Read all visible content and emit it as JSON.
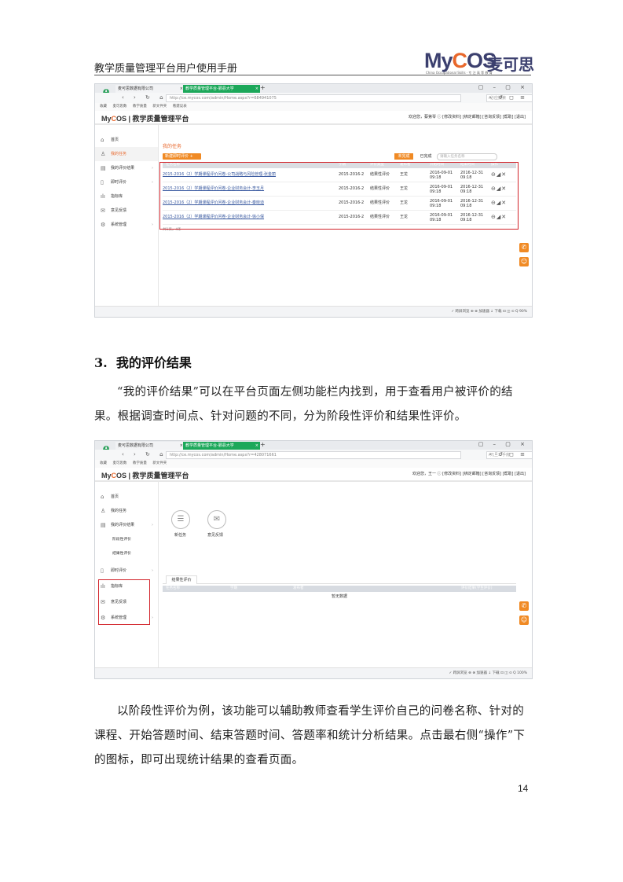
{
  "header": {
    "title": "教学质量管理平台用户使用手册",
    "logo_brand_prefix": "My",
    "logo_brand_o": "C",
    "logo_brand_suffix": "OS",
    "logo_cn": "麦可思",
    "logo_sub": "China Occupational Skills · 专 注 高 等 教 育"
  },
  "shot1": {
    "tabs": [
      "麦可思数据有限公司",
      "教学质量管理平台-鄞县大学"
    ],
    "url": "http://ce.mycos.com/admin/Home.aspx?r=684941075",
    "search_placeholder": "必应搜索",
    "favorites": [
      "收藏",
      "麦可思数",
      "教学质量",
      "新文件夹",
      "看建议表"
    ],
    "app_title": "教学质量管理平台",
    "user_info": "欢迎您，蔡第琴 ⓘ   [修改资料] [绑定邮箱] [咨询反馈] [帮助] [退出]",
    "sidebar": [
      "首页",
      "我的任务",
      "我的评价结果",
      "即时评价",
      "指标库",
      "意见反馈",
      "系统管理"
    ],
    "breadcrumb": "我的任务",
    "new_button": "新建即时评价 +",
    "filter_unfinished": "未完成",
    "filter_finished": "已完成",
    "search_tasks": "请输入任务名称",
    "columns": [
      "任务名称",
      "学期",
      "评价类型",
      "发布者",
      "开始时间",
      "结束时间",
      "操作"
    ],
    "rows": [
      {
        "name": "2015-2016（2）学期课程评价问卷-公司战略与风险管理-张金丽",
        "term": "2015-2016-2",
        "type": "结果性评价",
        "who": "王龙",
        "start1": "2016-09-01",
        "start2": "09:18",
        "end1": "2016-12-31",
        "end2": "09:18"
      },
      {
        "name": "2015-2016（2）学期课程评价问卷-企业财务会计-李玉月",
        "term": "2015-2016-2",
        "type": "结果性评价",
        "who": "王龙",
        "start1": "2016-09-01",
        "start2": "09:18",
        "end1": "2016-12-31",
        "end2": "09:18"
      },
      {
        "name": "2015-2016（2）学期课程评价问卷-企业财务会计-秦晓迪",
        "term": "2015-2016-2",
        "type": "结果性评价",
        "who": "王龙",
        "start1": "2016-09-01",
        "start2": "09:18",
        "end1": "2016-12-31",
        "end2": "09:18"
      },
      {
        "name": "2015-2016（2）学期课程评价问卷-企业财务会计-徐小保",
        "term": "2015-2016-2",
        "type": "结果性评价",
        "who": "王龙",
        "start1": "2016-09-01",
        "start2": "09:18",
        "end1": "2016-12-31",
        "end2": "09:18"
      }
    ],
    "total": "共1页，4条",
    "status": "✓ 跨屏浏览   ⊕   ⊗ 加速器  ↓ 下载  ⊡  ◫  ⊙  Q 90%"
  },
  "section": {
    "number": "3.",
    "title": "我的评价结果",
    "para1": "“我的评价结果”可以在平台页面左侧功能栏内找到，用于查看用户被评价的结果。根据调查时间点、针对问题的不同，分为阶段性评价和结果性评价。",
    "para2": "以阶段性评价为例，该功能可以辅助教师查看学生评价自己的问卷名称、针对的课程、开始答题时间、结束答题时间、答题率和统计分析结果。点击最右侧“操作”下的图标，即可出现统计结果的查看页面。"
  },
  "shot2": {
    "tabs": [
      "麦可思数据有限公司",
      "教学质量管理平台-鄞县大学"
    ],
    "url": "http://ce.mycos.com/admin/Home.aspx?r=428071661",
    "search_placeholder": "元旦二手房",
    "favorites": [
      "收藏",
      "麦可思数",
      "教学质量",
      "新文件夹"
    ],
    "app_title": "教学质量管理平台",
    "user_info": "欢迎您，王一 ⓘ   [修改资料] [绑定邮箱] [咨询反馈] [帮助] [退出]",
    "sidebar": [
      "首页",
      "我的任务",
      "我的评价结果"
    ],
    "sub_items": [
      "阶段性评价",
      "结果性评价"
    ],
    "sidebar_after": [
      "即时评价",
      "指标库",
      "意见反馈",
      "系统管理"
    ],
    "icons": [
      "新任务",
      "意见反馈"
    ],
    "tab": "结果性评价",
    "columns": [
      "任务名称",
      "学期",
      "发布者",
      "评价结果(学生评价)"
    ],
    "empty": "暂无数据",
    "status": "✓ 跨屏浏览   ⊕   ⊗ 加速器  ↓ 下载  ⊡  ◫  ⊙  Q 100%"
  },
  "page_number": "14"
}
